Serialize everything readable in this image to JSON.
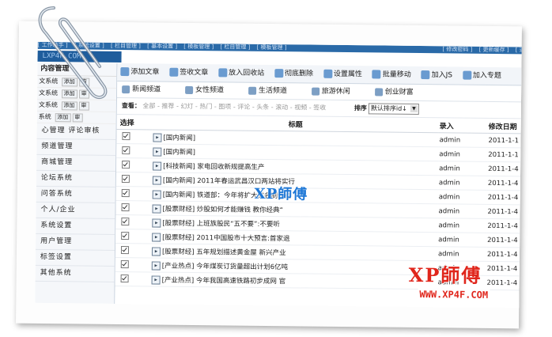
{
  "topbar": {
    "left_items": [
      "[ 工作助手 ]",
      "[ 系统设置 ]",
      "[ 栏目管理 ]",
      "[ 基本设置 ]",
      "[ 模板管理 ]",
      "[ 栏目管理 ]",
      "[ 模板管理 ]"
    ],
    "right_items": [
      "[ 修改密码 ]",
      "[ 更新缓存 ]",
      "[ 退出 ]"
    ]
  },
  "logo": "LXP4F.COM",
  "sidebar": {
    "header": "内容管理",
    "sub_rows": [
      {
        "label": "文系统",
        "btns": [
          "添加",
          "审"
        ]
      },
      {
        "label": "文系统",
        "btns": [
          "添加",
          "审"
        ]
      },
      {
        "label": "文系统",
        "btns": [
          "添加",
          "审"
        ]
      },
      {
        "label": "系统",
        "btns": [
          "添加",
          "审"
        ]
      }
    ],
    "items": [
      "心管理 评论审核",
      "频道管理",
      "商城管理",
      "论坛系统",
      "问答系统",
      "个人/企业",
      "系统设置",
      "用户管理",
      "标签设置",
      "其他系统"
    ]
  },
  "toolbar": {
    "items": [
      "添加文章",
      "签收文章",
      "放入回收站",
      "彻底删除",
      "设置属性",
      "批量移动",
      "加入JS",
      "加入专题"
    ]
  },
  "channels": [
    "新闻频道",
    "女性频道",
    "生活频道",
    "旅游休闲",
    "创业财富"
  ],
  "filter": {
    "label": "查看：",
    "options": "全部 - 推荐 - 幻灯 - 热门 - 图项 - 评论 - 头条 - 滚动 - 视频 - 签收",
    "sort_label": "排序",
    "sort_value": "默认排序id↓"
  },
  "table": {
    "headers": {
      "select": "选择",
      "title": "标题",
      "author": "录入",
      "date": "修改日期"
    },
    "rows": [
      {
        "title": "[国内新闻]",
        "author": "admin",
        "date": "2011-1-1"
      },
      {
        "title": "[国内新闻]",
        "author": "admin",
        "date": "2011-1-1"
      },
      {
        "title": "[科技新闻] 家电回收新规提高生产",
        "author": "admin",
        "date": "2011-1-4"
      },
      {
        "title": "[国内新闻] 2011年春运武昌汉口两站将实行",
        "author": "admin",
        "date": "2011-1-4"
      },
      {
        "title": "[国内新闻] 铁道部：今年将扩大实名制试点",
        "author": "admin",
        "date": "2011-1-4"
      },
      {
        "title": "[股票财经] 炒股如何才能赚钱 教你经典“",
        "author": "admin",
        "date": "2011-1-4"
      },
      {
        "title": "[股票财经] 上班族股民“五不要”:不要听",
        "author": "admin",
        "date": "2011-1-4"
      },
      {
        "title": "[股票财经] 2011中国股市十大预言:首家退",
        "author": "admin",
        "date": "2011-1-4"
      },
      {
        "title": "[股票财经] 五年规划描述黄金屋 新兴产业",
        "author": "admin",
        "date": "2011-1-4"
      },
      {
        "title": "[产业热点] 今年煤炭订货量超出计划6亿吨",
        "author": "admin",
        "date": "2011-1-4"
      },
      {
        "title": "[产业热点] 今年我国高速铁路初步成网 官",
        "author": "admin",
        "date": "2011-1-4"
      }
    ]
  },
  "watermarks": {
    "blue": "XP師傅",
    "red": "XP師傅",
    "url": "WWW.XP4F.COM"
  },
  "colors": {
    "header_blue": "#2a6aa8",
    "watermark_red": "#e0261c",
    "watermark_blue": "#1f78d6"
  }
}
